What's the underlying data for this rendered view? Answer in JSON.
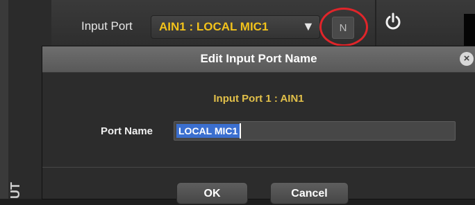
{
  "toolbar": {
    "input_port_label": "Input Port",
    "selected_port": "AIN1 : LOCAL MIC1",
    "dropdown_arrow": "▼",
    "name_button_label": "N",
    "power_icon": "power-icon"
  },
  "side_panel": {
    "label": "UT"
  },
  "dialog": {
    "title": "Edit Input Port Name",
    "subtitle": "Input Port 1 : AIN1",
    "port_name_label": "Port Name",
    "port_name_value": "LOCAL MIC1",
    "ok_label": "OK",
    "cancel_label": "Cancel",
    "close_glyph": "×"
  },
  "colors": {
    "accent_yellow": "#f2c21b",
    "highlight_red": "#e0252a",
    "selection_blue": "#3b6fcf"
  }
}
